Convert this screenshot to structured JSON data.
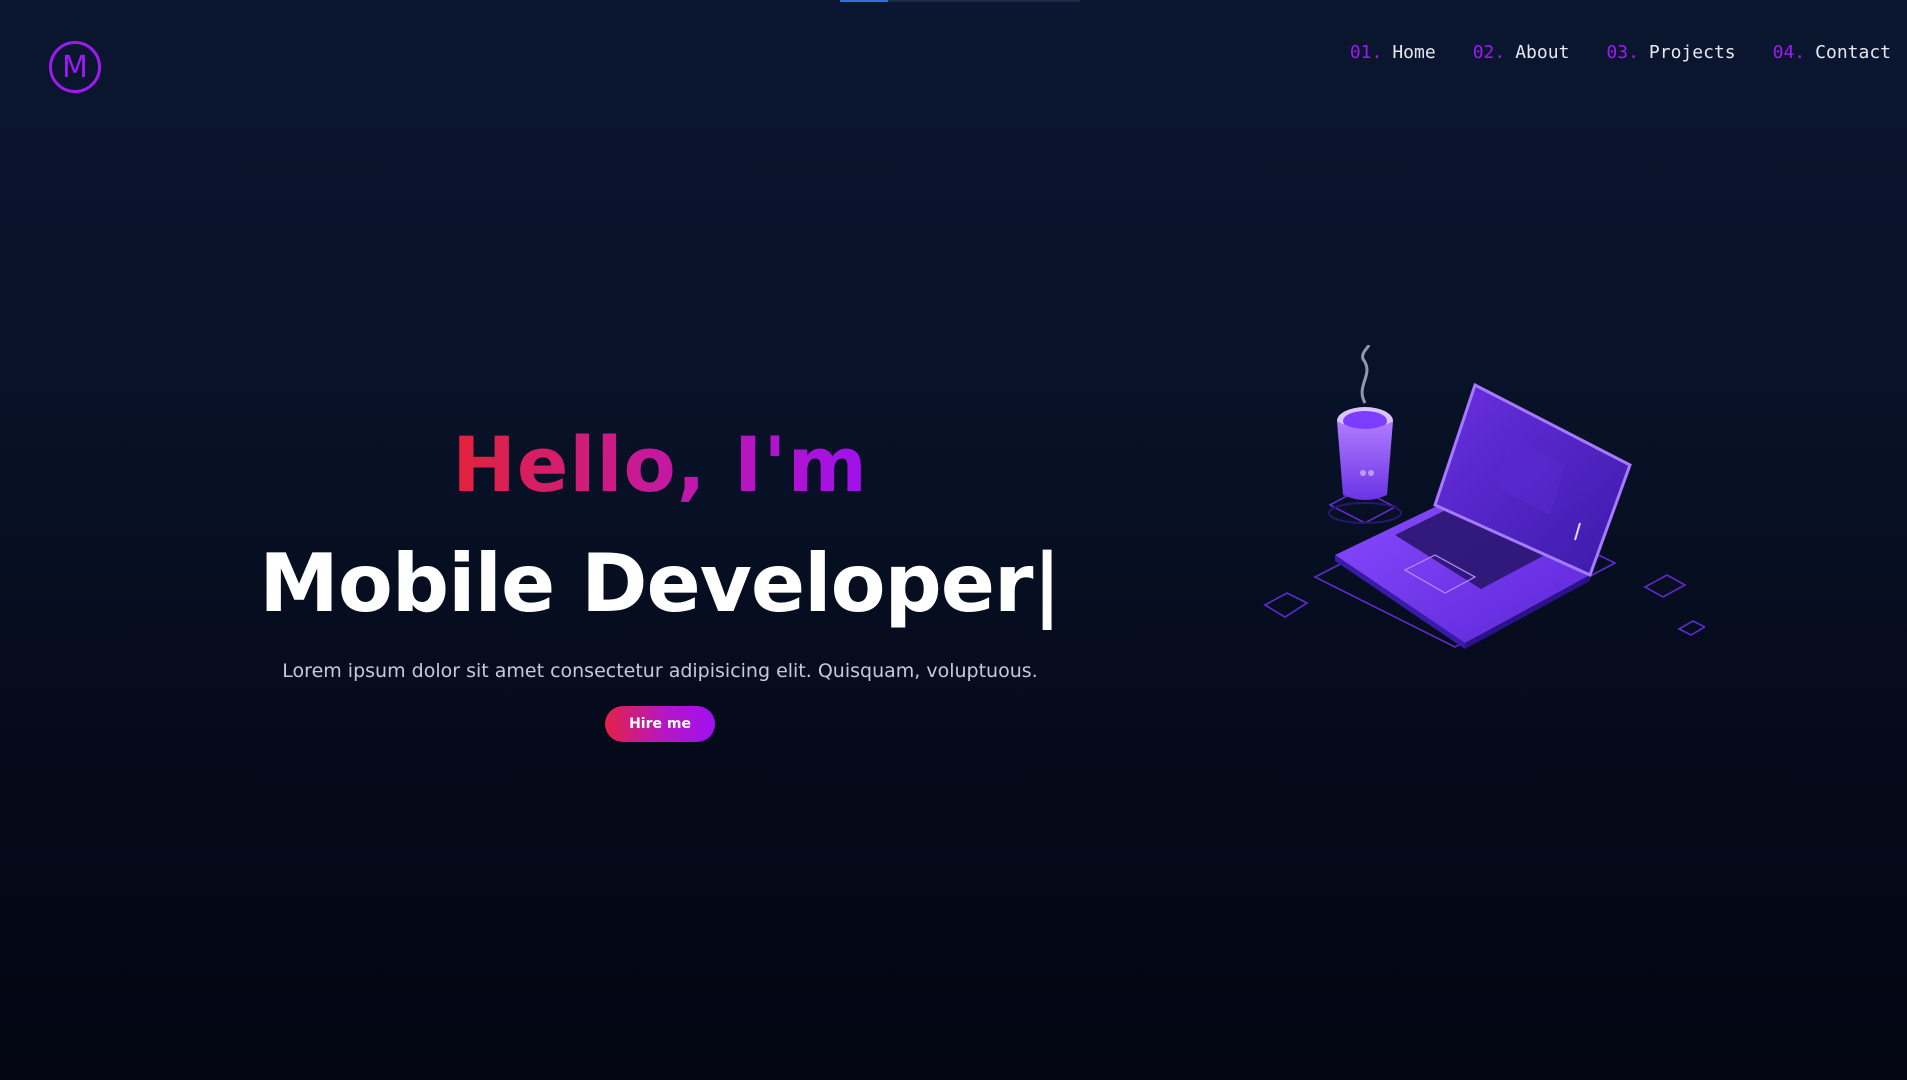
{
  "page_progress": 0.2,
  "logo": {
    "letter": "M"
  },
  "nav": {
    "items": [
      {
        "num": "01.",
        "label": "Home"
      },
      {
        "num": "02.",
        "label": "About"
      },
      {
        "num": "03.",
        "label": "Projects"
      },
      {
        "num": "04.",
        "label": "Contact"
      }
    ]
  },
  "hero": {
    "greeting": "Hello, I'm",
    "role": "Mobile Developer|",
    "description": "Lorem ipsum dolor sit amet consectetur adipisicing elit. Quisquam, voluptuous.",
    "cta_label": "Hire me"
  },
  "colors": {
    "accent": "#9d1bf0",
    "gradient_start": "#e3223a",
    "gradient_end": "#a010f0",
    "background": "#081228"
  },
  "icons": [
    "logo-monogram-icon",
    "laptop-coffee-illustration"
  ]
}
